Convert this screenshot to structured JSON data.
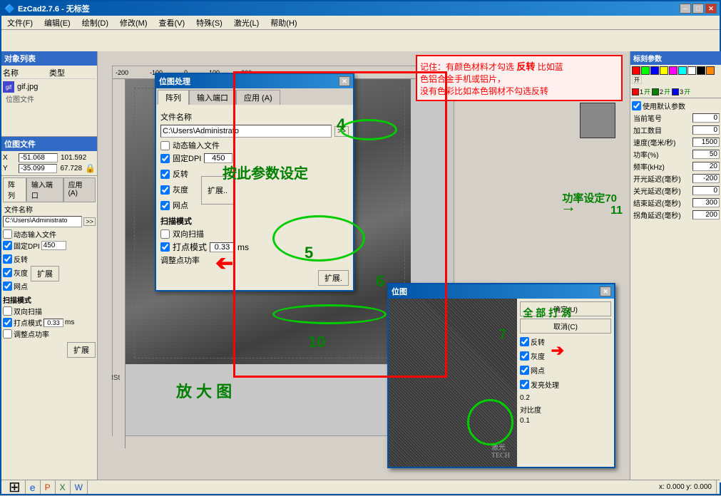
{
  "app": {
    "title": "EzCad2.7.6 - 无标签",
    "titleBar": {
      "minimize": "─",
      "maximize": "□",
      "close": "✕"
    }
  },
  "menubar": {
    "items": [
      "文件(F)",
      "编辑(E)",
      "绘制(D)",
      "修改(M)",
      "查看(V)",
      "特殊(S)",
      "激光(L)",
      "帮助(H)"
    ]
  },
  "leftPanel": {
    "title": "对象列表",
    "columns": [
      "名称",
      "类型"
    ],
    "item": {
      "name": "gif.jpg",
      "type": "位图文件"
    },
    "posTitle": "位图文件",
    "posX": "-51.068",
    "posY": "-35.099",
    "sizeW": "101.592",
    "sizeH": "67.728",
    "lockIcon": "🔒"
  },
  "leftSubPanel": {
    "tabs": [
      "阵列",
      "输入端口",
      "应用(A)"
    ],
    "activeTab": 0,
    "fileName": "文件名称",
    "fileValue": "C:\\Users\\Administrato",
    "dynamicInput": "动态输入文件",
    "fixedDPI": "固定DPI",
    "dpiValue": "450",
    "checkboxes": {
      "reverse": "反转",
      "expand1": "扩展",
      "gray": "灰度",
      "dotMode": "网点",
      "scanMode": "扫描模式",
      "biScan": "双向扫描",
      "dotModeCheck": "打点模式",
      "dotValue": "0.33",
      "dotUnit": "ms",
      "adjustPower": "调整点功率"
    },
    "expandBtn": "扩展",
    "expandBtn2": "扩展."
  },
  "centerDialog": {
    "title": "位图处理",
    "tabs": [
      "阵列",
      "输入端口",
      "应用 (A)"
    ],
    "activeTab": 0,
    "fileName": "文件名称",
    "fileValue": "C:\\Users\\Administrato",
    "browseBtnLabel": ">>",
    "dynamicInput": "动态输入文件",
    "fixedDPI": "固定DPI",
    "dpiValue": "450",
    "options": {
      "reverse": "反转",
      "gray": "灰度",
      "dot": "网点"
    },
    "expandBtnLabel": "扩展..",
    "scanMode": "扫描模式",
    "biScan": "双向扫描",
    "dotMode": "打点模式",
    "dotValue": "0.33",
    "dotUnit": "ms",
    "adjustPower": "调整点功率",
    "expandBtn2": "扩展."
  },
  "rightPanel": {
    "title": "标刻参数",
    "useDefault": "使用默认参数",
    "penNum": "当前笔号",
    "penValue": "0",
    "processCount": "加工数目",
    "processValue": "0",
    "speed": "速度 (毫米/秒)",
    "speedValue": "1500",
    "power": "功率(%)",
    "powerValue": "50",
    "freq": "频率(kHz)",
    "freqValue": "20",
    "onDelay": "开光延迟(毫秒)",
    "onDelayValue": "-200",
    "offDelay": "关光延迟(毫秒)",
    "offDelayValue": "0",
    "endDelay": "结束延迟(毫秒)",
    "endDelayValue": "300",
    "turnDelay": "拐角延迟(毫秒)",
    "turnDelayValue": "200",
    "colors": [
      "red",
      "green",
      "blue",
      "yellow",
      "magenta",
      "cyan",
      "white",
      "black",
      "orange",
      "pink",
      "lime",
      "teal"
    ]
  },
  "noteBox": {
    "text1": "记住：有颜色材料才勾选",
    "boldText": "反转",
    "text2": "比如蓝色铝合金手机或铝片，",
    "text3": "没有色彩比如本色钢材不勾选反转"
  },
  "annotations": {
    "num4": "4",
    "setupText": "按此参数设定",
    "num5": "5",
    "num6": "6",
    "num10": "10",
    "enlargeText": "放 大 图",
    "powerText": "功率设定70",
    "num7": "7",
    "num11": "11",
    "allPrintText": "全 部 打 涡"
  },
  "bitmapDialog": {
    "title": "位图",
    "confirmBtn": "确定(U)",
    "cancelBtn": "取消(C)",
    "checkboxes": {
      "reverse": "反转",
      "gray": "灰度",
      "dot": "网点",
      "bloom": "发亮处理"
    },
    "brightness": "0.2",
    "contrast": "对比度",
    "contrastValue": "0.1",
    "laserWatermark": "激光"
  },
  "statusBar": {
    "coords": "x: 0.000  y: 0.000",
    "info": ""
  }
}
